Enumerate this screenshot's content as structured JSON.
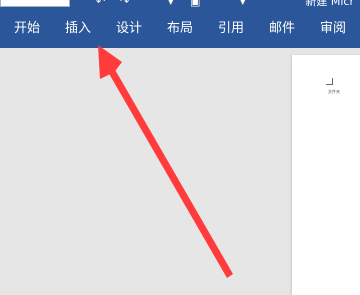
{
  "window": {
    "title": "新建 Micr"
  },
  "ribbon": {
    "tabs": [
      {
        "label": "开始"
      },
      {
        "label": "插入"
      },
      {
        "label": "设计"
      },
      {
        "label": "布局"
      },
      {
        "label": "引用"
      },
      {
        "label": "邮件"
      },
      {
        "label": "审阅"
      }
    ]
  },
  "document": {
    "page_text": "文件夹"
  },
  "colors": {
    "ribbon_bg": "#2b579a",
    "workspace_bg": "#e6e6e6",
    "arrow": "#ff3b3b"
  }
}
